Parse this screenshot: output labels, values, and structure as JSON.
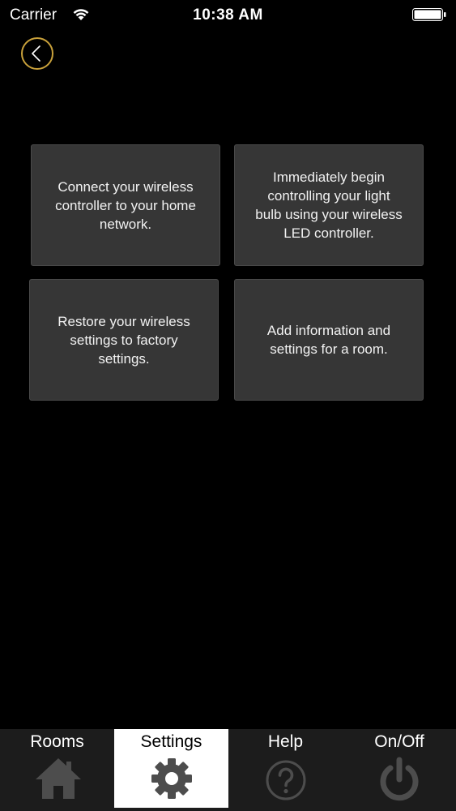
{
  "status_bar": {
    "carrier": "Carrier",
    "time": "10:38 AM"
  },
  "tiles": [
    {
      "text": "Connect your wireless controller to your home network."
    },
    {
      "text": "Immediately begin controlling your light bulb using your wireless LED controller."
    },
    {
      "text": "Restore your wireless settings to factory settings."
    },
    {
      "text": "Add information and settings for a room."
    }
  ],
  "tab_bar": {
    "tabs": [
      {
        "label": "Rooms",
        "icon": "home-icon"
      },
      {
        "label": "Settings",
        "icon": "gear-icon",
        "active": true
      },
      {
        "label": "Help",
        "icon": "question-icon"
      },
      {
        "label": "On/Off",
        "icon": "power-icon"
      }
    ]
  },
  "colors": {
    "background": "#000000",
    "tile": "#363636",
    "accent": "#c9a13b",
    "tab_bar": "#1c1c1c",
    "tab_active": "#ffffff",
    "tab_icon": "#4a4a4a"
  }
}
